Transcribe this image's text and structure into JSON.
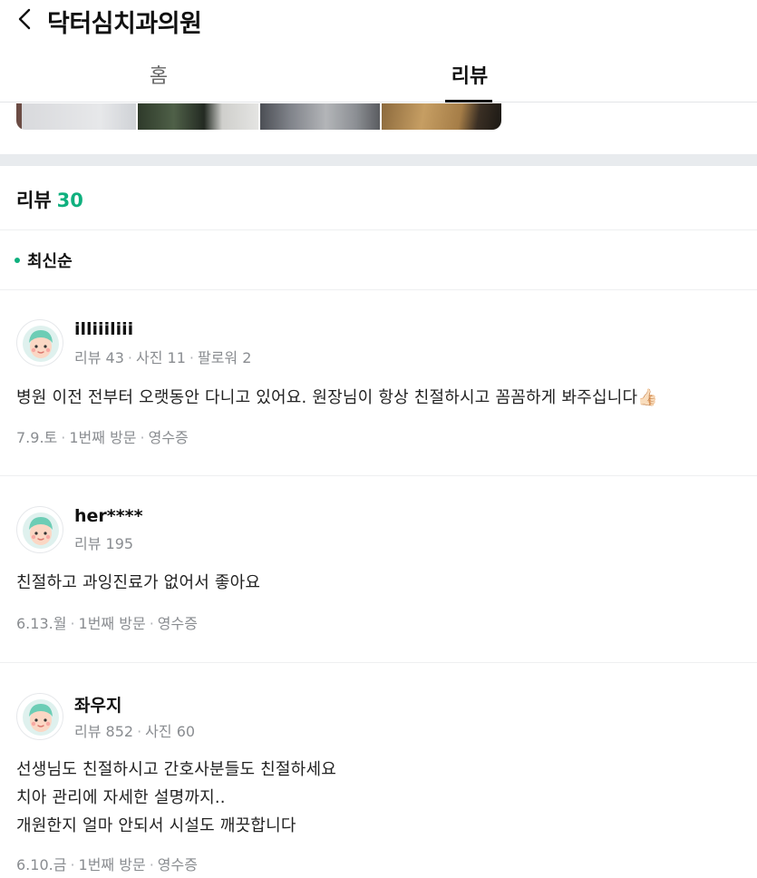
{
  "header": {
    "title": "닥터심치과의원",
    "tabs": [
      {
        "label": "홈",
        "active": false
      },
      {
        "label": "리뷰",
        "active": true
      }
    ]
  },
  "reviews_section": {
    "heading": "리뷰",
    "count": "30",
    "sort_label": "최신순"
  },
  "reviews": [
    {
      "nickname": "illiiiliii",
      "stats": [
        "리뷰 43",
        "사진 11",
        "팔로워 2"
      ],
      "text": "병원 이전 전부터 오랫동안 다니고 있어요. 원장님이 항상 친절하시고 꼼꼼하게 봐주십니다👍🏻",
      "visit": [
        "7.9.토",
        "1번째 방문",
        "영수증"
      ]
    },
    {
      "nickname": "her****",
      "stats": [
        "리뷰 195"
      ],
      "text": "친절하고 과잉진료가 없어서 좋아요",
      "visit": [
        "6.13.월",
        "1번째 방문",
        "영수증"
      ]
    },
    {
      "nickname": "좌우지",
      "stats": [
        "리뷰 852",
        "사진 60"
      ],
      "text_lines": [
        "선생님도 친절하시고 간호사분들도 친절하세요",
        "치아 관리에 자세한 설명까지..",
        "개원한지 얼마 안되서 시설도 깨끗합니다"
      ],
      "visit": [
        "6.10.금",
        "1번째 방문",
        "영수증"
      ]
    }
  ],
  "icons": {
    "back": "chevron-left-icon",
    "avatar": "default-avatar-icon",
    "emoji": "thumbs-up-icon"
  },
  "colors": {
    "accent": "#0fb07e",
    "divider": "#e8ebee"
  }
}
